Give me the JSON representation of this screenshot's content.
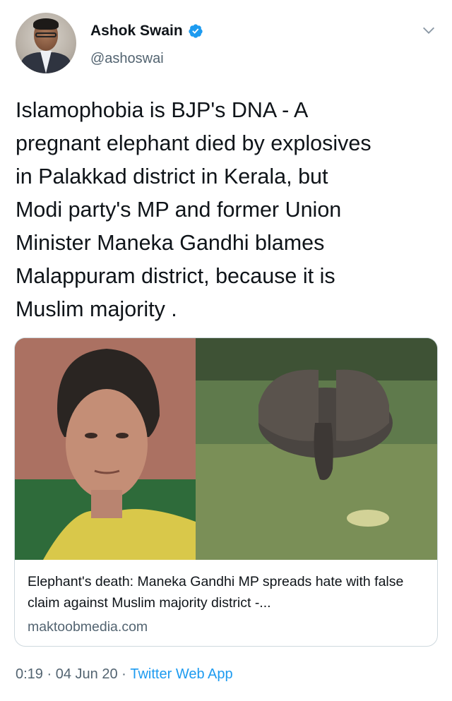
{
  "author": {
    "name": "Ashok Swain",
    "handle": "@ashoswai",
    "verified": true
  },
  "tweet": {
    "text": "Islamophobia is BJP's DNA - A\npregnant elephant died by explosives\nin Palakkad district in Kerala, but\nModi party's MP and former Union\nMinister Maneka Gandhi blames\nMalappuram district, because it is\nMuslim majority ."
  },
  "card": {
    "headline": "Elephant's death: Maneka Gandhi MP spreads hate with false claim against Muslim majority district -...",
    "domain": "maktoobmedia.com"
  },
  "meta": {
    "time": "0:19",
    "separator": " · ",
    "date": "04 Jun 20",
    "source": "Twitter Web App"
  },
  "icons": {
    "verified": "verified-badge-icon",
    "more": "chevron-down-icon"
  },
  "colors": {
    "accent": "#1d9bf0",
    "secondary_text": "#536471",
    "primary_text": "#0f1419",
    "border": "#cfd9de"
  }
}
